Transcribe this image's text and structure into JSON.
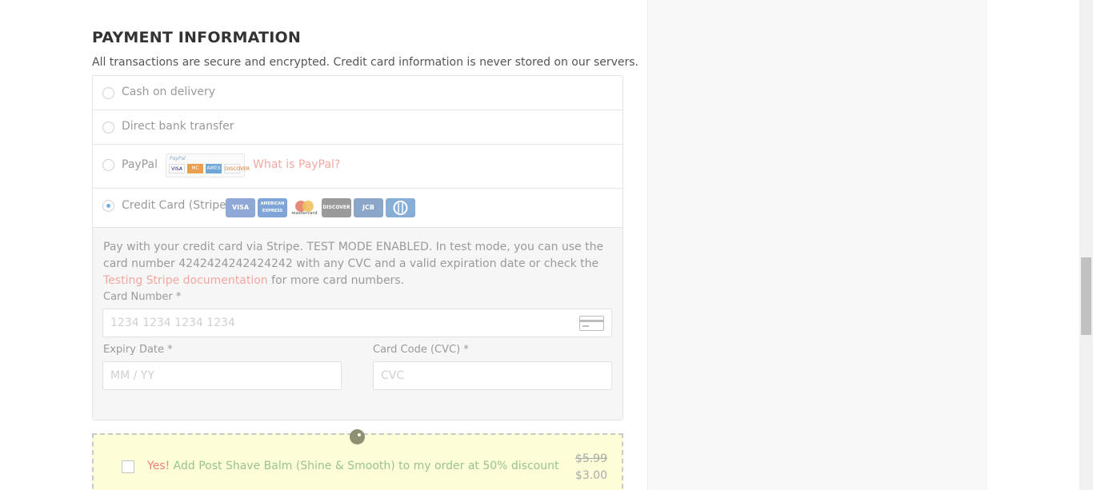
{
  "payment": {
    "title": "PAYMENT INFORMATION",
    "subtitle": "All transactions are secure and encrypted. Credit card information is never stored on our servers.",
    "methods": [
      {
        "label": "Cash on delivery",
        "selected": false
      },
      {
        "label": "Direct bank transfer",
        "selected": false
      },
      {
        "label": "PayPal",
        "selected": false,
        "link": "What is PayPal?"
      },
      {
        "label": "Credit Card (Stripe)",
        "selected": true
      }
    ],
    "paypal_badge": "PayPal",
    "paypal_card_names": [
      "VISA",
      "MC",
      "AMEX",
      "DISCOVER"
    ],
    "stripe_cards": [
      "VISA",
      "AMERICAN EXPRESS",
      "mastercard",
      "DISCOVER",
      "JCB",
      "Diners"
    ],
    "stripe_desc_1": "Pay with your credit card via Stripe. TEST MODE ENABLED. In test mode, you can use the card number 4242424242424242 with any CVC and a valid expiration date or check the ",
    "stripe_desc_link": "Testing Stripe documentation",
    "stripe_desc_2": " for more card numbers.",
    "card_number": {
      "label": "Card Number *",
      "placeholder": "1234 1234 1234 1234"
    },
    "expiry": {
      "label": "Expiry Date *",
      "placeholder": "MM / YY"
    },
    "cvc": {
      "label": "Card Code (CVC) *",
      "placeholder": "CVC"
    }
  },
  "offer": {
    "yes": "Yes!",
    "text": " Add Post Shave Balm (Shine & Smooth) to my order at 50% discount",
    "old_price": "$5.99",
    "new_price": "$3.00"
  },
  "colors": {
    "accent_link": "#f4a7a0",
    "offer_bg": "#fdfdd8",
    "offer_text": "#9bc48a",
    "radio_selected": "#6db3e8"
  }
}
